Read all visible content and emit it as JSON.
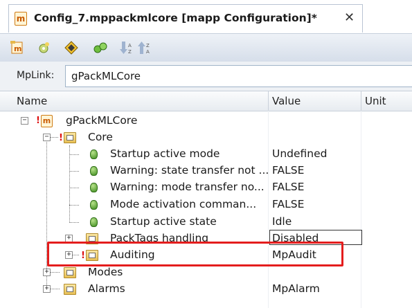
{
  "tab": {
    "title": "Config_7.mppackmlcore [mapp Configuration]*",
    "close": "✕",
    "icon_letter": "m"
  },
  "toolbar": {
    "buttons": [
      "new-config-icon",
      "gear-add-icon",
      "navigate-icon",
      "expand-icon",
      "sort-asc-icon",
      "sort-desc-icon"
    ]
  },
  "mplink": {
    "label": "MpLink:",
    "value": "gPackMLCore"
  },
  "grid": {
    "columns": {
      "name": "Name",
      "value": "Value",
      "unit": "Unit"
    },
    "rows": [
      {
        "name": "gPackMLCore",
        "value": ""
      },
      {
        "name": "Core",
        "value": ""
      },
      {
        "name": "Startup active mode",
        "value": "Undefined"
      },
      {
        "name": "Warning: state transfer not ...",
        "value": "FALSE"
      },
      {
        "name": "Warning: mode transfer no...",
        "value": "FALSE"
      },
      {
        "name": "Mode activation comman...",
        "value": "FALSE"
      },
      {
        "name": "Startup active state",
        "value": "Idle"
      },
      {
        "name": "PackTags handling",
        "value": "Disabled"
      },
      {
        "name": "Auditing",
        "value": "MpAudit"
      },
      {
        "name": "Modes",
        "value": ""
      },
      {
        "name": "Alarms",
        "value": "MpAlarm"
      }
    ]
  },
  "colors": {
    "highlight": "#e41d1d",
    "accent": "#cf7a12"
  }
}
